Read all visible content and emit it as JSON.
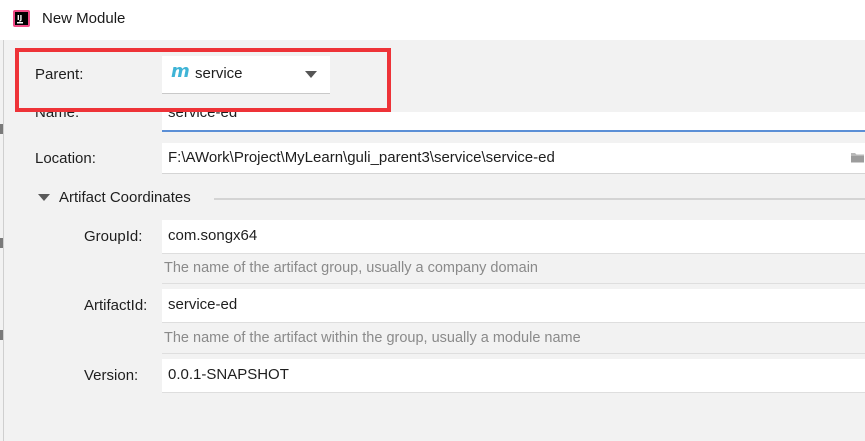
{
  "window": {
    "title": "New Module",
    "icon": "intellij-idea-icon"
  },
  "form": {
    "parent_label": "Parent:",
    "parent_value": "service",
    "parent_icon": "maven-module-icon",
    "name_label": "Name:",
    "name_value": "service-ed",
    "location_label": "Location:",
    "location_value": "F:\\AWork\\Project\\MyLearn\\guli_parent3\\service\\service-ed",
    "location_icon": "folder-icon"
  },
  "artifact": {
    "section_title": "Artifact Coordinates",
    "groupid_label": "GroupId:",
    "groupid_value": "com.songx64",
    "groupid_hint": "The name of the artifact group, usually a company domain",
    "artifactid_label": "ArtifactId:",
    "artifactid_value": "service-ed",
    "artifactid_hint": "The name of the artifact within the group, usually a module name",
    "version_label": "Version:",
    "version_value": "0.0.1-SNAPSHOT"
  },
  "colors": {
    "highlight": "#ee3338",
    "focus_underline": "#5b8fd6",
    "module_icon": "#3fb4d6"
  }
}
